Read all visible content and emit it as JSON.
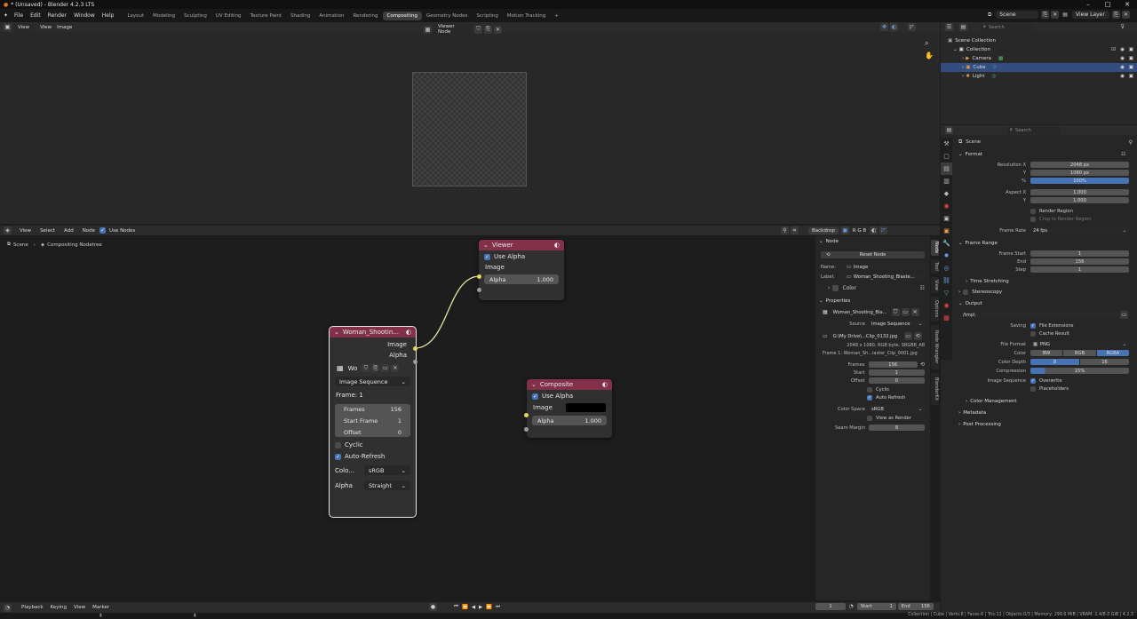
{
  "titlebar": {
    "title": "* (Unsaved) - Blender 4.2.3 LTS",
    "min": "–",
    "max": "□",
    "close": "✕"
  },
  "menubar": {
    "menus": [
      "File",
      "Edit",
      "Render",
      "Window",
      "Help"
    ],
    "workspaces": [
      "Layout",
      "Modeling",
      "Sculpting",
      "UV Editing",
      "Texture Paint",
      "Shading",
      "Animation",
      "Rendering",
      "Compositing",
      "Geometry Nodes",
      "Scripting",
      "Motion Tracking"
    ],
    "add_tab": "+",
    "scene": "Scene",
    "view_layer": "View Layer"
  },
  "image_editor": {
    "menus": [
      "View",
      "View",
      "Image"
    ],
    "active_image": "Viewer Node"
  },
  "node_editor": {
    "menus": [
      "View",
      "Select",
      "Add",
      "Node"
    ],
    "use_nodes": "Use Nodes",
    "breadcrumb": [
      "Scene",
      "Compositing Nodetree"
    ],
    "backdrop": "Backdrop",
    "channels": "R G B",
    "viewer": {
      "title": "Viewer",
      "use_alpha": "Use Alpha",
      "image": "Image",
      "alpha_label": "Alpha",
      "alpha_value": "1.000"
    },
    "composite": {
      "title": "Composite",
      "use_alpha": "Use Alpha",
      "image": "Image",
      "alpha_label": "Alpha",
      "alpha_value": "1.000"
    },
    "image_node": {
      "title": "Woman_Shootin...",
      "out_image": "Image",
      "out_alpha": "Alpha",
      "image_short": "Wo",
      "source": "Image Sequence",
      "frame": "Frame: 1",
      "frames_label": "Frames",
      "frames": "156",
      "start_label": "Start Frame",
      "start": "1",
      "offset_label": "Offset",
      "offset": "0",
      "cyclic": "Cyclic",
      "auto_refresh": "Auto-Refresh",
      "color_label": "Colo...",
      "color": "sRGB",
      "alpha_label": "Alpha",
      "alpha": "Straight"
    }
  },
  "node_sidebar": {
    "node_header": "Node",
    "reset": "Reset Node",
    "name_label": "Name:",
    "name": "Image",
    "label_label": "Label:",
    "label": "Woman_Shooting_Blaste...",
    "color": "Color",
    "properties": "Properties",
    "image": "Woman_Shooting_Bla...",
    "source_label": "Source",
    "source": "Image Sequence",
    "filepath": "G:\\My Drive\\...Clip_0132.jpg",
    "info": "2048 x 1080, RGB byte, SRGB8_A8",
    "frame_info": "Frame 1: Woman_Sh...laster_Clip_0001.jpg",
    "frames_label": "Frames",
    "frames": "156",
    "start_label": "Start",
    "start": "1",
    "offset_label": "Offset",
    "offset": "0",
    "cyclic": "Cyclic",
    "auto_refresh": "Auto Refresh",
    "colorspace_label": "Color Space",
    "colorspace": "sRGB",
    "view_as_render": "View as Render",
    "seam_label": "Seam Margin",
    "seam": "8",
    "tabs": [
      "Node",
      "Tool",
      "View",
      "Options",
      "Node Wrangler",
      "BlenderKit"
    ]
  },
  "outliner": {
    "search": "Search",
    "items": [
      {
        "label": "Scene Collection",
        "indent": 0
      },
      {
        "label": "Collection",
        "indent": 1
      },
      {
        "label": "Camera",
        "indent": 2
      },
      {
        "label": "Cube",
        "indent": 2
      },
      {
        "label": "Light",
        "indent": 2
      }
    ]
  },
  "properties": {
    "search": "Search",
    "scene": "Scene",
    "format": "Format",
    "res_x_label": "Resolution X",
    "res_x": "2048 px",
    "res_y_label": "Y",
    "res_y": "1080 px",
    "pct_label": "%",
    "pct": "100%",
    "aspect_x_label": "Aspect X",
    "aspect_x": "1.000",
    "aspect_y_label": "Y",
    "aspect_y": "1.000",
    "render_region": "Render Region",
    "crop": "Crop to Render Region",
    "frame_rate_label": "Frame Rate",
    "frame_rate": "24 fps",
    "frame_range": "Frame Range",
    "frame_start_label": "Frame Start",
    "frame_start": "1",
    "end_label": "End",
    "end": "156",
    "step_label": "Step",
    "step": "1",
    "time_stretching": "Time Stretching",
    "stereoscopy": "Stereoscopy",
    "output": "Output",
    "path": "/tmp\\",
    "saving_label": "Saving",
    "file_ext": "File Extensions",
    "cache": "Cache Result",
    "file_format_label": "File Format",
    "file_format": "PNG",
    "color_label": "Color",
    "color_opts": [
      "BW",
      "RGB",
      "RGBA"
    ],
    "depth_label": "Color Depth",
    "depth_opts": [
      "8",
      "16"
    ],
    "compression_label": "Compression",
    "compression": "15%",
    "img_seq_label": "Image Sequence",
    "overwrite": "Overwrite",
    "placeholders": "Placeholders",
    "color_mgmt": "Color Management",
    "metadata": "Metadata",
    "post": "Post Processing"
  },
  "timeline": {
    "menus": [
      "Playback",
      "Keying",
      "View",
      "Marker"
    ],
    "current": "1",
    "start_label": "Start",
    "start": "1",
    "end_label": "End",
    "end": "156"
  },
  "statusbar": {
    "text": "Collection | Cube | Verts:8 | Faces:6 | Tris:12 | Objects:0/3 | Memory: 299.6 MiB | VRAM: 2.4/8.0 GiB | 4.2.3"
  }
}
